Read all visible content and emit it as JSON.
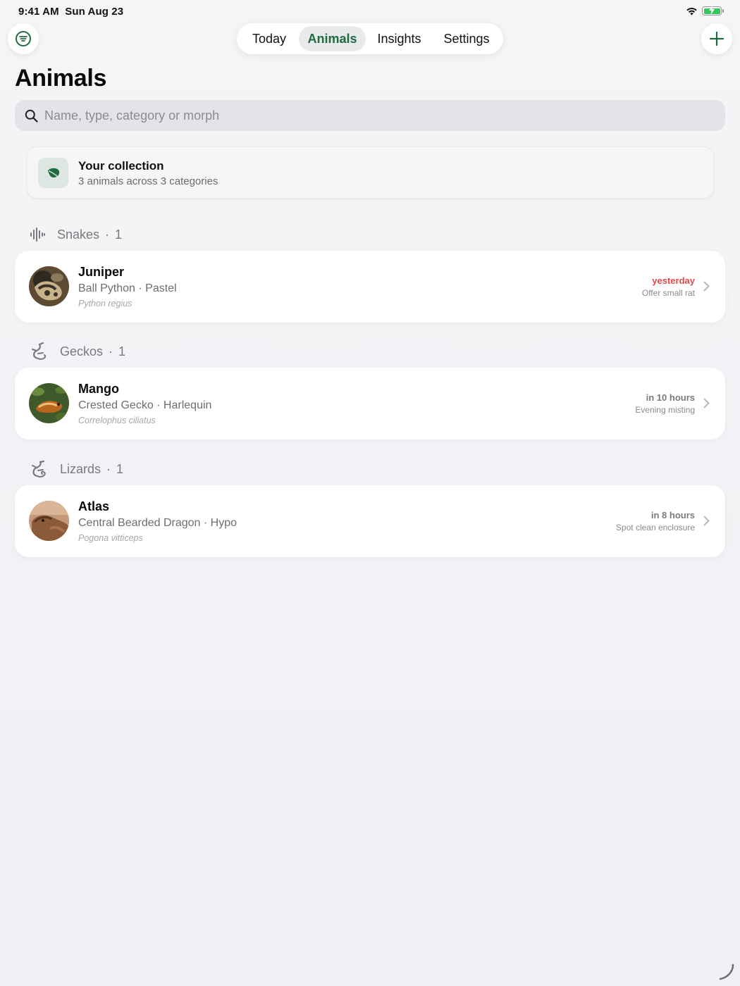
{
  "status_bar": {
    "time": "9:41 AM",
    "date": "Sun Aug 23",
    "icons": [
      "wifi-icon",
      "battery-charging-icon"
    ],
    "battery_color": "#34c759"
  },
  "top_bar": {
    "menu_icon": "filter-list-icon",
    "add_icon": "plus-icon",
    "tabs": [
      {
        "label": "Today",
        "active": false
      },
      {
        "label": "Animals",
        "active": true
      },
      {
        "label": "Insights",
        "active": false
      },
      {
        "label": "Settings",
        "active": false
      }
    ],
    "accent": "#1f6b3f"
  },
  "page": {
    "title": "Animals"
  },
  "search": {
    "placeholder": "Name, type, category or morph",
    "value": "",
    "icon": "search-icon"
  },
  "collection": {
    "icon": "leaf-icon",
    "title": "Your collection",
    "subtitle": "3 animals across 3 categories"
  },
  "sections": [
    {
      "name": "Snakes",
      "separator": "·",
      "count": "1",
      "icon": "snake-icon",
      "animals": [
        {
          "name": "Juniper",
          "breed": "Ball Python · Pastel",
          "scientific": "Python regius",
          "due": "yesterday",
          "due_state": "overdue",
          "task": "Offer small rat",
          "avatar_color": "#6b5a3e"
        }
      ]
    },
    {
      "name": "Geckos",
      "separator": "·",
      "count": "1",
      "icon": "gecko-icon",
      "animals": [
        {
          "name": "Mango",
          "breed": "Crested Gecko · Harlequin",
          "scientific": "Correlophus ciliatus",
          "due": "in 10 hours",
          "due_state": "upcoming",
          "task": "Evening misting",
          "avatar_color": "#8a5a2b"
        }
      ]
    },
    {
      "name": "Lizards",
      "separator": "·",
      "count": "1",
      "icon": "lizard-icon",
      "animals": [
        {
          "name": "Atlas",
          "breed": "Central Bearded Dragon · Hypo",
          "scientific": "Pogona vitticeps",
          "due": "in 8 hours",
          "due_state": "upcoming",
          "task": "Spot clean enclosure",
          "avatar_color": "#b07850"
        }
      ]
    }
  ],
  "colors": {
    "overdue": "#e0494a",
    "muted": "#7a7a7e"
  }
}
